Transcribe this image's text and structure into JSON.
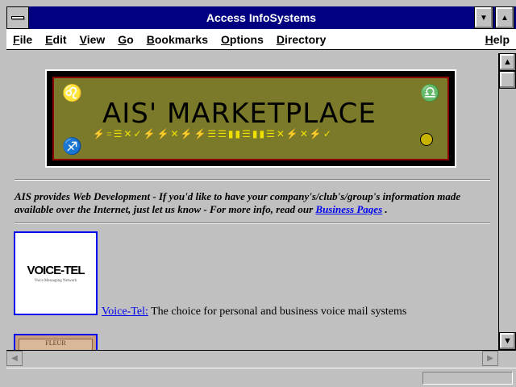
{
  "window": {
    "title": "Access InfoSystems",
    "minimize_glyph": "▼",
    "maximize_glyph": "▲"
  },
  "menu": {
    "items": [
      {
        "label": "File"
      },
      {
        "label": "Edit"
      },
      {
        "label": "View"
      },
      {
        "label": "Go"
      },
      {
        "label": "Bookmarks"
      },
      {
        "label": "Options"
      },
      {
        "label": "Directory"
      }
    ],
    "help": "Help"
  },
  "banner": {
    "title": "AIS' MARKETPLACE",
    "glyph_row": "⚡=☰✕✓⚡⚡✕⚡⚡☰☰▮▮☰▮▮☰✕⚡✕⚡✓",
    "icons": [
      "leo-icon",
      "libra-icon",
      "sagittarius-icon",
      "moon-icon"
    ]
  },
  "intro": {
    "text": "AIS provides Web Development - If you'd like to have your company's/club's/group's information made available over the Internet, just let us know - For more info, read our ",
    "link": "Business Pages",
    "suffix": " ."
  },
  "listings": [
    {
      "logo": "VOICE-TEL",
      "logo_sub": "Voice Messaging Network",
      "link": "Voice-Tel:",
      "description": " The choice for personal and business voice mail systems"
    },
    {
      "logo": "FLEUR"
    }
  ],
  "colors": {
    "titlebar": "#000080",
    "link": "#0000ee",
    "page_bg": "#c0c0c0",
    "banner_bg": "#7a7a2a"
  }
}
